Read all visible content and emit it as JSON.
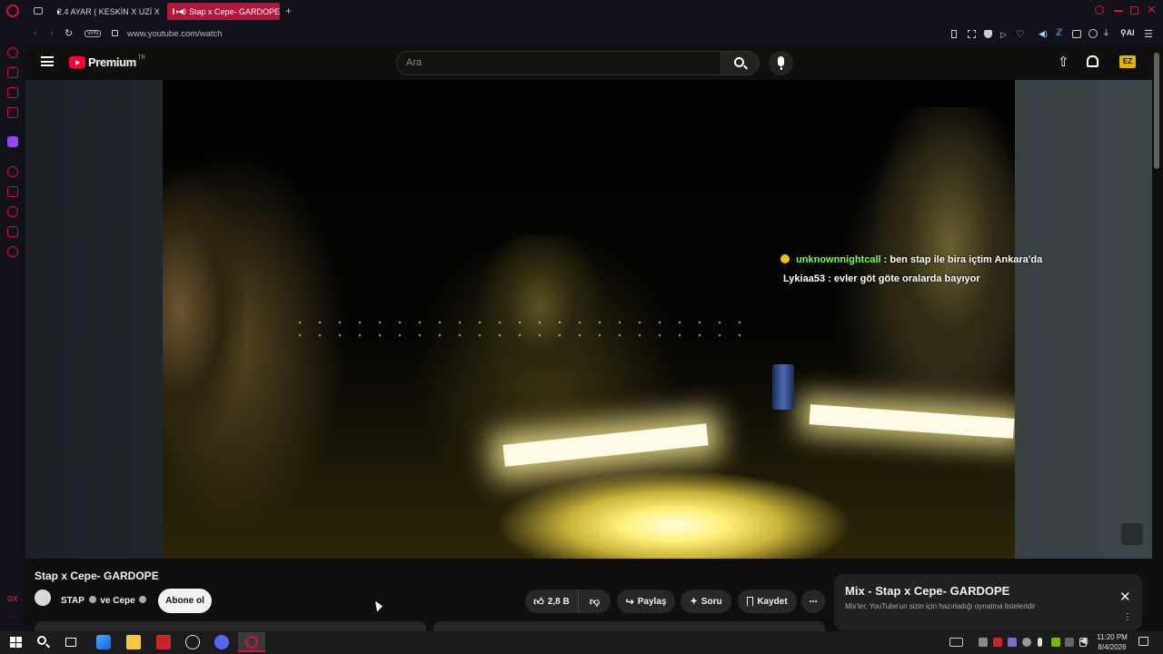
{
  "browser": {
    "tabs": [
      {
        "label": "2.4 AYAR ( KESKİN X UZİ X"
      },
      {
        "label": "Stap x Cepe- GARDOPE"
      }
    ],
    "new_tab": "+",
    "url": "www.youtube.com/watch",
    "vpn_label": "VPN",
    "ai_label": "AI",
    "sidebar_gx_label": "GX"
  },
  "youtube": {
    "logo_text": "Premium",
    "logo_region": "TR",
    "search_placeholder": "Ara",
    "video": {
      "title": "Stap x Cepe- GARDOPE",
      "chat": [
        {
          "user": "unknownnightcall",
          "message": ": ben stap ile bira içtim Ankara'da",
          "user_color": "#7dff4a"
        },
        {
          "user": "Lykiaa53",
          "message": ": evler göt göte oralarda bayıyor",
          "user_color": "#ffffff"
        }
      ]
    },
    "channel": {
      "name_1": "STAP",
      "connector": "ve",
      "name_2": "Cepe",
      "subscribe_label": "Abone ol"
    },
    "actions": {
      "likes": "2,8 B",
      "share": "Paylaş",
      "ask": "Soru",
      "save": "Kaydet"
    },
    "mix": {
      "title": "Mix - Stap x Cepe- GARDOPE",
      "subtitle": "Mix'ler, YouTube'un sizin için hazırladığı oynatma listeleridir"
    }
  },
  "taskbar": {
    "time": "11:20 PM",
    "date": "8/4/2026"
  },
  "colors": {
    "accent": "#c9163c",
    "tab_active": "#b3183a",
    "youtube_red": "#ff0033"
  }
}
